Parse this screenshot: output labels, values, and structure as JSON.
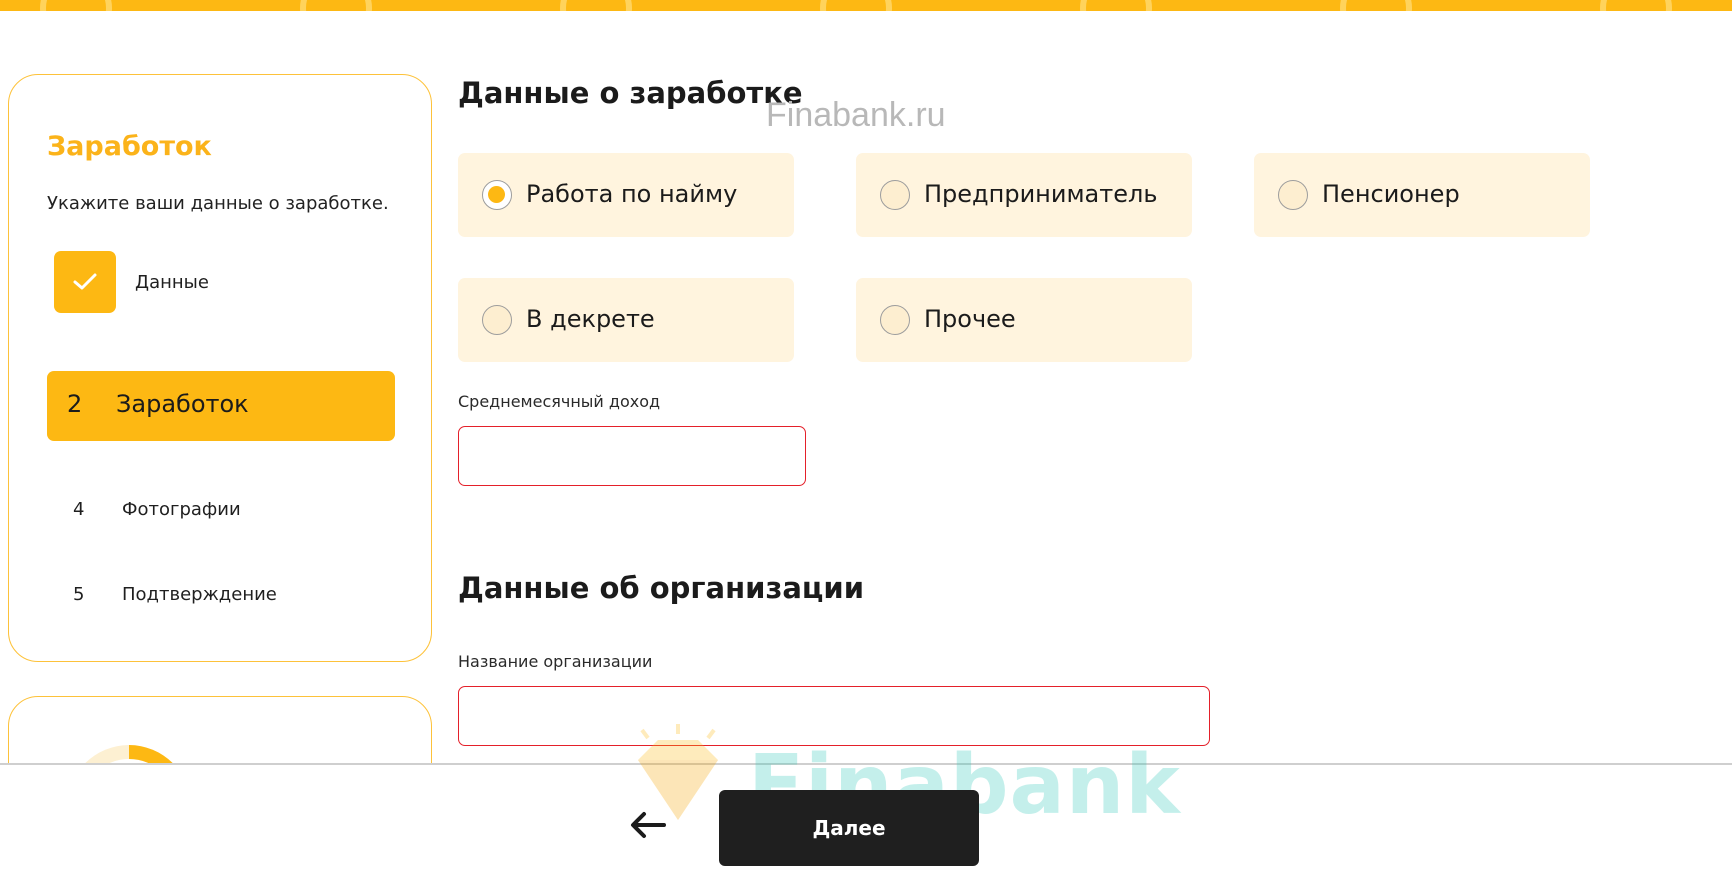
{
  "watermark": {
    "top_text": "Finabank.ru",
    "brand": "Finabank"
  },
  "sidebar": {
    "title": "Заработок",
    "description": "Укажите ваши данные о заработке.",
    "steps": [
      {
        "num": "",
        "label": "Данные",
        "status": "done"
      },
      {
        "num": "2",
        "label": "Заработок",
        "status": "active"
      },
      {
        "num": "4",
        "label": "Фотографии",
        "status": "pending"
      },
      {
        "num": "5",
        "label": "Подтверждение",
        "status": "pending"
      }
    ]
  },
  "income": {
    "title": "Данные о заработке",
    "options": [
      {
        "label": "Работа по найму",
        "selected": true
      },
      {
        "label": "Предприниматель",
        "selected": false
      },
      {
        "label": "Пенсионер",
        "selected": false
      },
      {
        "label": "В декрете",
        "selected": false
      },
      {
        "label": "Прочее",
        "selected": false
      }
    ],
    "avg_income_label": "Среднемесячный доход",
    "avg_income_value": ""
  },
  "organization": {
    "title": "Данные об организации",
    "name_label": "Название организации",
    "name_value": ""
  },
  "footer": {
    "next_label": "Далее"
  },
  "colors": {
    "accent": "#fdb813",
    "option_bg": "#fff4de",
    "error": "#e4202a",
    "dark_button": "#1f1f1f"
  }
}
